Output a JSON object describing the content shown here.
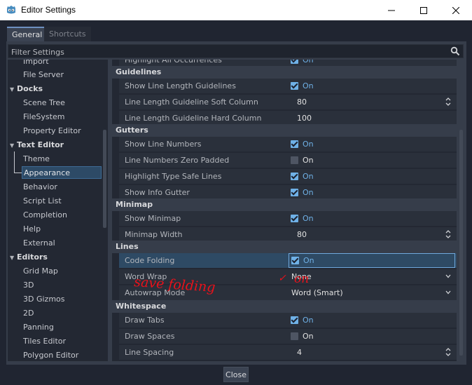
{
  "window": {
    "title": "Editor Settings",
    "minimize_glyph": "—",
    "maximize_glyph": "☐",
    "close_glyph": "✕"
  },
  "tabs": [
    {
      "label": "General",
      "active": true
    },
    {
      "label": "Shortcuts",
      "active": false
    }
  ],
  "filter": {
    "placeholder": "Filter Settings",
    "icon": "search-icon"
  },
  "tree": {
    "items": [
      {
        "label": "Import",
        "level": 1
      },
      {
        "label": "File Server",
        "level": 1
      },
      {
        "label": "Docks",
        "level": 0
      },
      {
        "label": "Scene Tree",
        "level": 1
      },
      {
        "label": "FileSystem",
        "level": 1
      },
      {
        "label": "Property Editor",
        "level": 1
      },
      {
        "label": "Text Editor",
        "level": 0
      },
      {
        "label": "Theme",
        "level": 1
      },
      {
        "label": "Appearance",
        "level": 1,
        "selected": true
      },
      {
        "label": "Behavior",
        "level": 1
      },
      {
        "label": "Script List",
        "level": 1
      },
      {
        "label": "Completion",
        "level": 1
      },
      {
        "label": "Help",
        "level": 1
      },
      {
        "label": "External",
        "level": 1
      },
      {
        "label": "Editors",
        "level": 0
      },
      {
        "label": "Grid Map",
        "level": 1
      },
      {
        "label": "3D",
        "level": 1
      },
      {
        "label": "3D Gizmos",
        "level": 1
      },
      {
        "label": "2D",
        "level": 1
      },
      {
        "label": "Panning",
        "level": 1
      },
      {
        "label": "Tiles Editor",
        "level": 1
      },
      {
        "label": "Polygon Editor",
        "level": 1
      }
    ]
  },
  "settings": {
    "partial_row": {
      "label": "Highlight All Occurrences",
      "value": "On"
    },
    "sections": [
      {
        "title": "Guidelines",
        "rows": [
          {
            "label": "Show Line Length Guidelines",
            "kind": "check",
            "checked": true,
            "value": "On"
          },
          {
            "label": "Line Length Guideline Soft Column",
            "kind": "number",
            "value": "80"
          },
          {
            "label": "Line Length Guideline Hard Column",
            "kind": "number",
            "value": "100"
          }
        ]
      },
      {
        "title": "Gutters",
        "rows": [
          {
            "label": "Show Line Numbers",
            "kind": "check",
            "checked": true,
            "value": "On"
          },
          {
            "label": "Line Numbers Zero Padded",
            "kind": "check",
            "checked": false,
            "value": "On"
          },
          {
            "label": "Highlight Type Safe Lines",
            "kind": "check",
            "checked": true,
            "value": "On"
          },
          {
            "label": "Show Info Gutter",
            "kind": "check",
            "checked": true,
            "value": "On"
          }
        ]
      },
      {
        "title": "Minimap",
        "rows": [
          {
            "label": "Show Minimap",
            "kind": "check",
            "checked": true,
            "value": "On"
          },
          {
            "label": "Minimap Width",
            "kind": "number",
            "value": "80"
          }
        ]
      },
      {
        "title": "Lines",
        "rows": [
          {
            "label": "Code Folding",
            "kind": "check",
            "checked": true,
            "value": "On",
            "highlighted": true
          },
          {
            "label": "Word Wrap",
            "kind": "select",
            "value": "None"
          },
          {
            "label": "Autowrap Mode",
            "kind": "select",
            "value": "Word (Smart)"
          }
        ]
      },
      {
        "title": "Whitespace",
        "rows": [
          {
            "label": "Draw Tabs",
            "kind": "check",
            "checked": true,
            "value": "On"
          },
          {
            "label": "Draw Spaces",
            "kind": "check",
            "checked": false,
            "value": "On"
          },
          {
            "label": "Line Spacing",
            "kind": "number",
            "value": "4"
          }
        ]
      }
    ]
  },
  "annotation": {
    "text": "save folding",
    "mark": "✓",
    "mark_text": "on",
    "color": "#e8121b"
  },
  "footer": {
    "close_label": "Close"
  },
  "colors": {
    "accent": "#6fb1e7",
    "selection": "#2d4a66",
    "panel": "#363d4a",
    "background": "#202531"
  }
}
